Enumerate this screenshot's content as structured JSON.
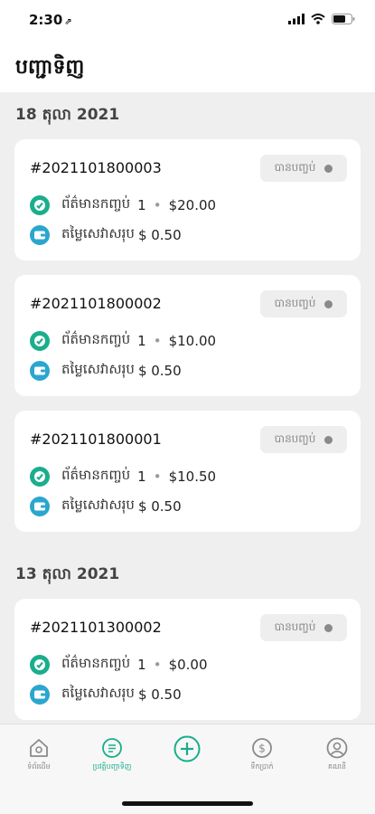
{
  "status_bar": {
    "time": "2:30",
    "location_glyph": "⇗"
  },
  "header": {
    "title": "បញ្ជាទិញ"
  },
  "badge_label": "បានបញ្ចប់",
  "item_label": "ព័ត៌មានកញ្ចប់",
  "fee_label": "តម្លៃសេវាសរុប",
  "groups": [
    {
      "date": "18 តុលា 2021",
      "orders": [
        {
          "id": "#2021101800003",
          "count": "1",
          "amount": "$20.00",
          "fee": "$ 0.50"
        },
        {
          "id": "#2021101800002",
          "count": "1",
          "amount": "$10.00",
          "fee": "$ 0.50"
        },
        {
          "id": "#2021101800001",
          "count": "1",
          "amount": "$10.50",
          "fee": "$ 0.50"
        }
      ]
    },
    {
      "date": "13 តុលា 2021",
      "orders": [
        {
          "id": "#2021101300002",
          "count": "1",
          "amount": "$0.00",
          "fee": "$ 0.50"
        }
      ]
    }
  ],
  "tabbar": {
    "tabs": [
      {
        "label": "ទំព័រដើម",
        "icon": "home-icon",
        "active": false
      },
      {
        "label": "ប្រវត្តិបញ្ជាទិញ",
        "icon": "order-history-icon",
        "active": true
      },
      {
        "label": "",
        "icon": "add-icon",
        "active": false
      },
      {
        "label": "ទឹកប្រាក់",
        "icon": "wallet-icon",
        "active": false
      },
      {
        "label": "គណនី",
        "icon": "account-icon",
        "active": false
      }
    ]
  },
  "colors": {
    "accent": "#1aae8c",
    "icon_blue": "#2aa6cf",
    "badge_bg": "#eeeeee",
    "page_bg": "#efefef"
  }
}
